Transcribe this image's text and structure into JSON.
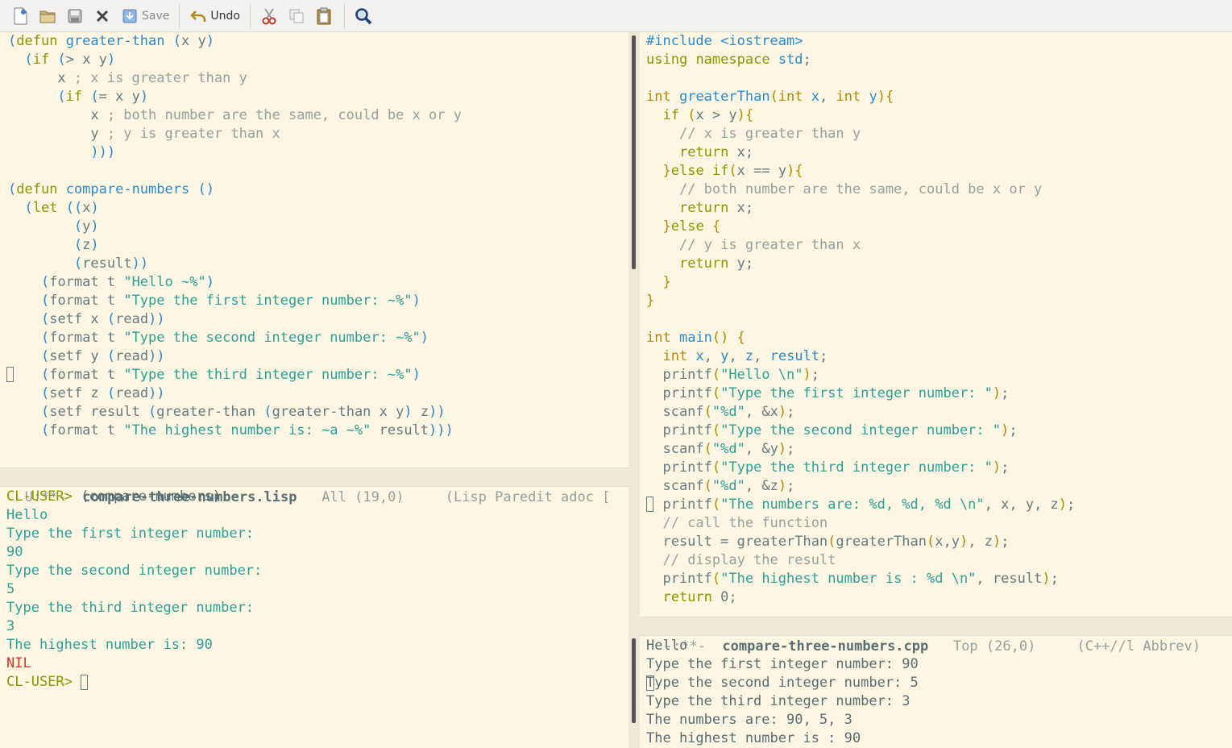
{
  "toolbar": {
    "save_label": "Save",
    "undo_label": "Undo"
  },
  "lisp": {
    "lines": [
      "(defun greater-than (x y)",
      "  (if (> x y)",
      "      x ; x is greater than y",
      "      (if (= x y)",
      "          x ; both number are the same, could be x or y",
      "          y ; y is greater than x",
      "          )))",
      "",
      "(defun compare-numbers ()",
      "  (let ((x)",
      "        (y)",
      "        (z)",
      "        (result))",
      "    (format t \"Hello ~%\")",
      "    (format t \"Type the first integer number: ~%\")",
      "    (setf x (read))",
      "    (format t \"Type the second integer number: ~%\")",
      "    (setf y (read))",
      "    (format t \"Type the third integer number: ~%\")",
      "    (setf z (read))",
      "    (setf result (greater-than (greater-than x y) z))",
      "    (format t \"The highest number is: ~a ~%\" result)))"
    ],
    "modeline": {
      "status": " U:**-  ",
      "buffer": "compare-three-numbers.lisp",
      "position": "   All (19,0)     ",
      "modes": "(Lisp Paredit adoc ["
    }
  },
  "repl": {
    "prompt": "CL-USER>",
    "command": " (compare-numbers)",
    "output": [
      "Hello",
      "Type the first integer number:",
      "90",
      "Type the second integer number:",
      "5",
      "Type the third integer number:",
      "3",
      "The highest number is: 90"
    ],
    "result": "NIL",
    "prompt2": "CL-USER> "
  },
  "cpp": {
    "lines": [
      "#include <iostream>",
      "using namespace std;",
      "",
      "int greaterThan(int x, int y){",
      "  if (x > y){",
      "    // x is greater than y",
      "    return x;",
      "  }else if(x == y){",
      "    // both number are the same, could be x or y",
      "    return x;",
      "  }else {",
      "    // y is greater than x",
      "    return y;",
      "  }",
      "}",
      "",
      "int main() {",
      "  int x, y, z, result;",
      "  printf(\"Hello \\n\");",
      "  printf(\"Type the first integer number: \");",
      "  scanf(\"%d\", &x);",
      "  printf(\"Type the second integer number: \");",
      "  scanf(\"%d\", &y);",
      "  printf(\"Type the third integer number: \");",
      "  scanf(\"%d\", &z);",
      "  printf(\"The numbers are: %d, %d, %d \\n\", x, y, z);",
      "  // call the function",
      "  result = greaterThan(greaterThan(x,y), z);",
      "  // display the result",
      "  printf(\"The highest number is : %d \\n\", result);",
      "  return 0;"
    ],
    "modeline": {
      "status": " -:**-  ",
      "buffer": "compare-three-numbers.cpp",
      "position": "   Top (26,0)     ",
      "modes": "(C++//l Abbrev)"
    }
  },
  "output_pane": {
    "lines": [
      "Hello",
      "Type the first integer number: 90",
      "Type the second integer number: 5",
      "Type the third integer number: 3",
      "The numbers are: 90, 5, 3",
      "The highest number is : 90"
    ]
  },
  "colors": {
    "background": "#fdf6e3",
    "keyword": "#859900",
    "function": "#268bd2",
    "string": "#2aa198",
    "comment": "#93a1a1",
    "error": "#dc322f"
  }
}
